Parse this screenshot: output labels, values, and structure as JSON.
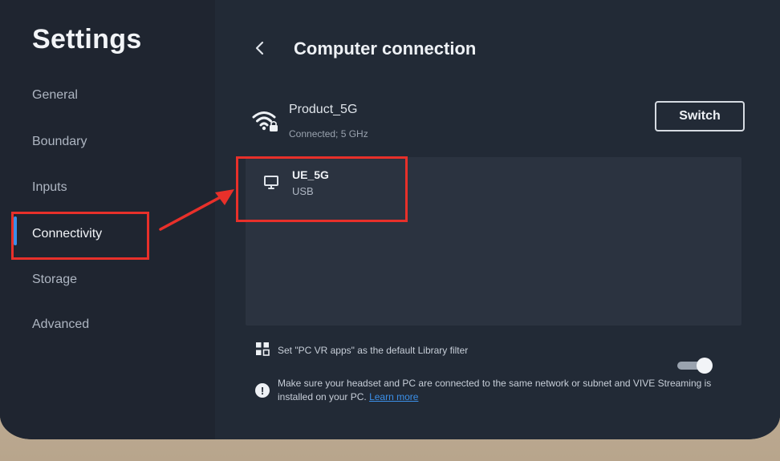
{
  "sidebar": {
    "title": "Settings",
    "items": [
      {
        "label": "General"
      },
      {
        "label": "Boundary"
      },
      {
        "label": "Inputs"
      },
      {
        "label": "Connectivity"
      },
      {
        "label": "Storage"
      },
      {
        "label": "Advanced"
      }
    ],
    "active_index": 3
  },
  "header": {
    "back_icon": "chevron-left-icon",
    "title": "Computer connection"
  },
  "wifi": {
    "icon": "wifi-lock-icon",
    "network_name": "Product_5G",
    "status": "Connected; 5 GHz",
    "switch_label": "Switch"
  },
  "devices": [
    {
      "icon": "monitor-icon",
      "name": "UE_5G",
      "connection": "USB"
    }
  ],
  "library_filter": {
    "icon": "grid-icon",
    "label": "Set \"PC VR apps\" as the default Library filter",
    "enabled": true
  },
  "info": {
    "icon": "info-icon",
    "text": "Make sure your headset and PC are connected to the same network or subnet and VIVE Streaming is installed on your PC.",
    "link": "Learn more"
  },
  "colors": {
    "accent": "#3b8fe8",
    "annotation": "#e8302a",
    "panel_bg": "#222a36",
    "sidebar_bg": "#1f2530"
  }
}
